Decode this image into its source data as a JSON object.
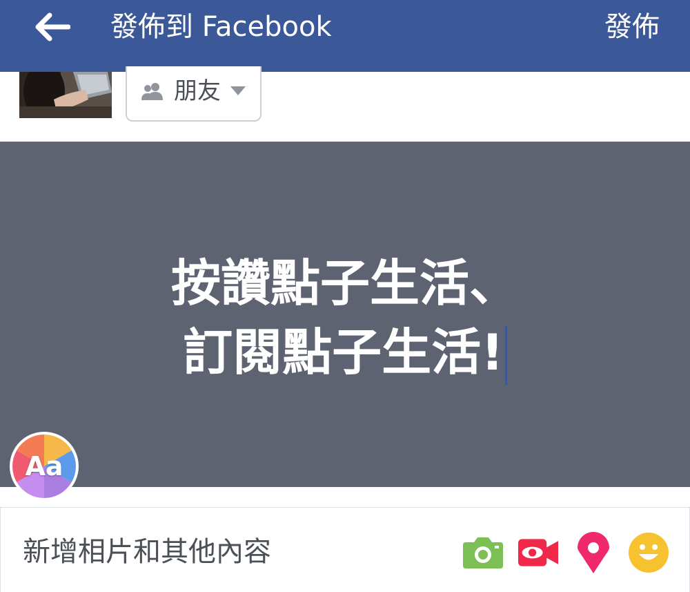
{
  "topbar": {
    "title": "發佈到 Facebook",
    "publish_label": "發佈",
    "color": "#3b5998"
  },
  "audience": {
    "label": "朋友",
    "icon": "friends-icon"
  },
  "composer": {
    "background": "#5d6371",
    "lines": [
      "按讚點子生活、",
      "訂閱點子生活!"
    ],
    "font_button_label": "Aa"
  },
  "add_bar": {
    "label": "新增相片和其他內容",
    "icons": [
      "camera-icon",
      "video-icon",
      "location-icon",
      "emoji-icon"
    ],
    "icon_colors": {
      "camera": "#7cbf55",
      "video": "#f0284a",
      "location": "#f0286e",
      "emoji": "#f7c22f"
    }
  }
}
